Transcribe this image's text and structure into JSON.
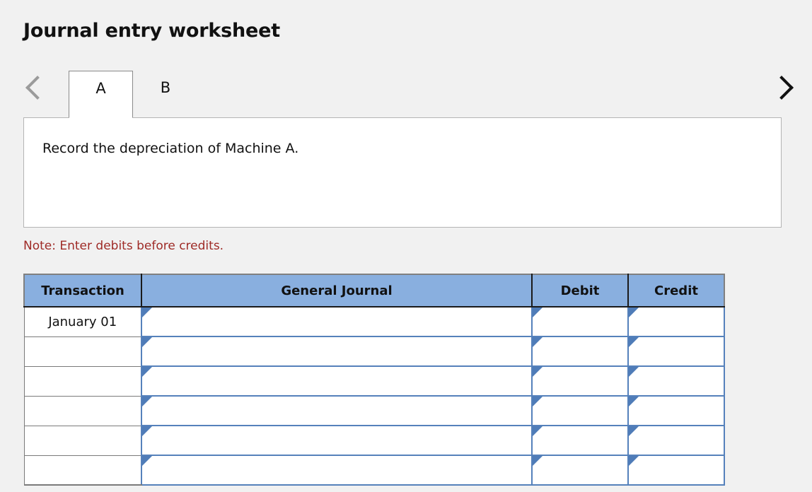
{
  "page": {
    "title": "Journal entry worksheet",
    "background_color": "#f1f1f1"
  },
  "tabs": {
    "prev_icon": "chevron-left-icon",
    "next_icon": "chevron-right-icon",
    "prev_enabled": false,
    "next_enabled": true,
    "items": [
      {
        "label": "A",
        "active": true
      },
      {
        "label": "B",
        "active": false
      }
    ]
  },
  "panel": {
    "text": "Record the depreciation of Machine A."
  },
  "note": {
    "text": "Note: Enter debits before credits.",
    "color": "#9e2a26"
  },
  "table": {
    "header_color": "#89afdf",
    "input_border_color": "#5581bb",
    "columns": [
      {
        "key": "transaction",
        "label": "Transaction"
      },
      {
        "key": "general_journal",
        "label": "General Journal"
      },
      {
        "key": "debit",
        "label": "Debit"
      },
      {
        "key": "credit",
        "label": "Credit"
      }
    ],
    "rows": [
      {
        "transaction": "January 01",
        "general_journal": "",
        "debit": "",
        "credit": ""
      },
      {
        "transaction": "",
        "general_journal": "",
        "debit": "",
        "credit": ""
      },
      {
        "transaction": "",
        "general_journal": "",
        "debit": "",
        "credit": ""
      },
      {
        "transaction": "",
        "general_journal": "",
        "debit": "",
        "credit": ""
      },
      {
        "transaction": "",
        "general_journal": "",
        "debit": "",
        "credit": ""
      },
      {
        "transaction": "",
        "general_journal": "",
        "debit": "",
        "credit": ""
      }
    ]
  }
}
